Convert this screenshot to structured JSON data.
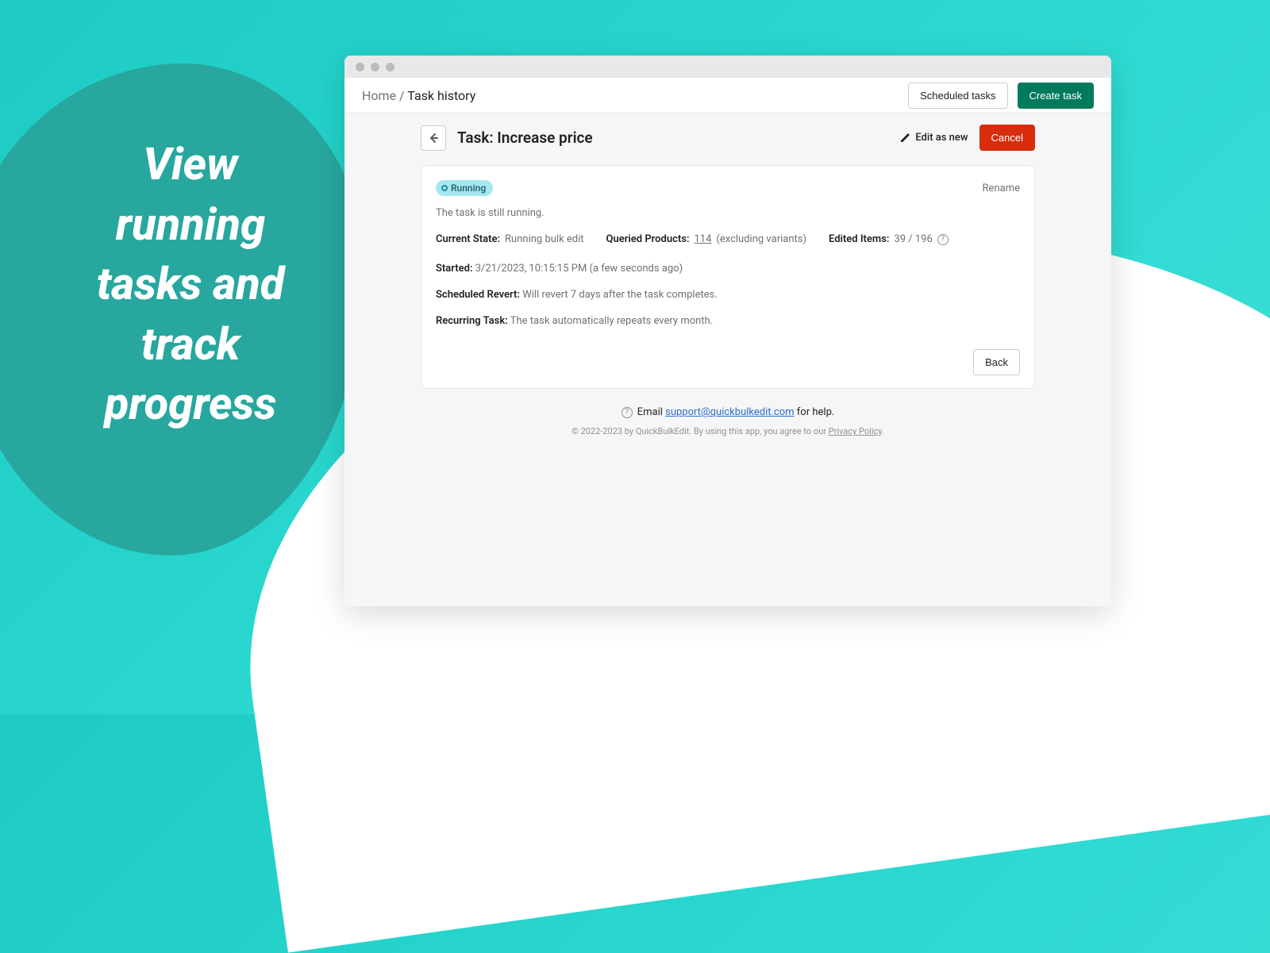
{
  "promo": "View running tasks and track progress",
  "breadcrumb": {
    "home": "Home",
    "sep": " / ",
    "current": "Task history"
  },
  "topbar": {
    "scheduled": "Scheduled tasks",
    "create": "Create task"
  },
  "header": {
    "title": "Task: Increase price",
    "edit_as_new": "Edit as new",
    "cancel": "Cancel"
  },
  "card": {
    "badge": "Running",
    "rename": "Rename",
    "status_text": "The task is still running.",
    "current_state": {
      "label": "Current State:",
      "value": "Running bulk edit"
    },
    "queried": {
      "label": "Queried Products:",
      "count": "114",
      "note": "(excluding variants)"
    },
    "edited": {
      "label": "Edited Items:",
      "value": "39 / 196"
    },
    "started": {
      "label": "Started:",
      "value": "3/21/2023, 10:15:15 PM (a few seconds ago)"
    },
    "revert": {
      "label": "Scheduled Revert:",
      "value": "Will revert 7 days after the task completes."
    },
    "recurring": {
      "label": "Recurring Task:",
      "value": "The task automatically repeats every month."
    },
    "back": "Back"
  },
  "footer": {
    "help_pre": "Email ",
    "help_email": "support@quickbulkedit.com",
    "help_post": " for help.",
    "copyright_pre": "© 2022-2023 by QuickBulkEdit. By using this app, you agree to our ",
    "privacy": "Privacy Policy",
    "copyright_post": "."
  }
}
